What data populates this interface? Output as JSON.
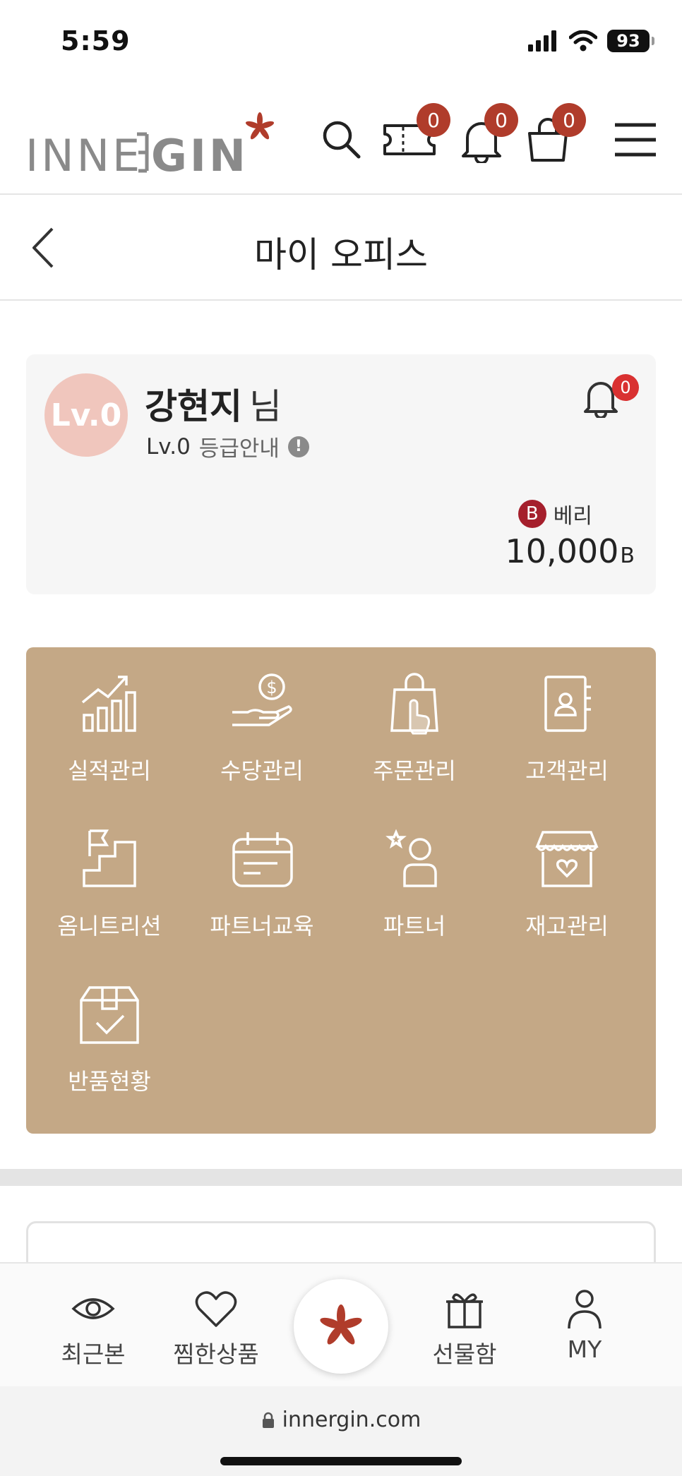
{
  "status_bar": {
    "time": "5:59",
    "battery": "93"
  },
  "header": {
    "logo_text": "INNERGIN",
    "coupon_count": "0",
    "notification_count": "0",
    "cart_count": "0"
  },
  "page": {
    "title": "마이 오피스"
  },
  "profile": {
    "level_badge": "Lv.0",
    "name": "강현지",
    "name_suffix": "님",
    "level": "Lv.0",
    "grade_guide": "등급안내",
    "alert_count": "0",
    "berry_icon_letter": "B",
    "berry_label": "베리",
    "berry_amount": "10,000",
    "berry_unit": "B"
  },
  "menu": {
    "items": [
      {
        "label": "실적관리",
        "icon": "performance-chart-icon"
      },
      {
        "label": "수당관리",
        "icon": "allowance-coin-icon"
      },
      {
        "label": "주문관리",
        "icon": "order-bag-icon"
      },
      {
        "label": "고객관리",
        "icon": "customer-book-icon"
      },
      {
        "label": "옴니트리션",
        "icon": "omnitrition-stairs-icon"
      },
      {
        "label": "파트너교육",
        "icon": "partner-education-calendar-icon"
      },
      {
        "label": "파트너",
        "icon": "partner-person-icon"
      },
      {
        "label": "재고관리",
        "icon": "inventory-store-icon"
      },
      {
        "label": "반품현황",
        "icon": "return-box-icon"
      }
    ]
  },
  "bottom_nav": {
    "recent": "최근본",
    "wishlist": "찜한상품",
    "gift": "선물함",
    "my": "MY"
  },
  "browser": {
    "url": "innergin.com"
  },
  "colors": {
    "accent": "#b03c2b",
    "menu_bg": "#c4a886",
    "level_bg": "#f0c6bd",
    "berry": "#a51f2c"
  }
}
